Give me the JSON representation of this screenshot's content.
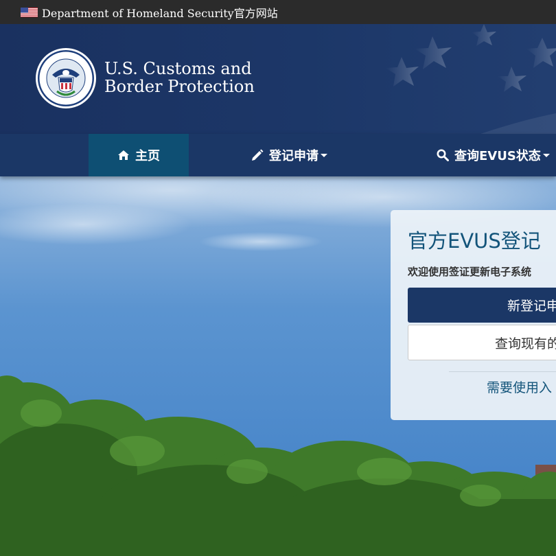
{
  "gov_banner": {
    "text": "Department of Homeland Security官方网站",
    "flag_icon": "us-flag-icon"
  },
  "header": {
    "seal_icon": "dhs-seal-icon",
    "agency_line1": "U.S. Customs and",
    "agency_line2": "Border Protection"
  },
  "nav": {
    "home": {
      "label": "主页",
      "icon": "home-icon",
      "active": true
    },
    "register": {
      "label": "登记申请",
      "icon": "pencil-icon"
    },
    "status": {
      "label": "查询EVUS状态",
      "icon": "search-icon"
    }
  },
  "card": {
    "title": "官方EVUS登记",
    "subtitle": "欢迎使用签证更新电子系统",
    "primary_button": "新登记申",
    "secondary_button": "查询现有的",
    "help_link": "需要使用入"
  },
  "colors": {
    "nav_bg": "#1b3766",
    "nav_active": "#0e4f73",
    "header_bg": "#1a3160",
    "accent_text": "#13547a"
  }
}
